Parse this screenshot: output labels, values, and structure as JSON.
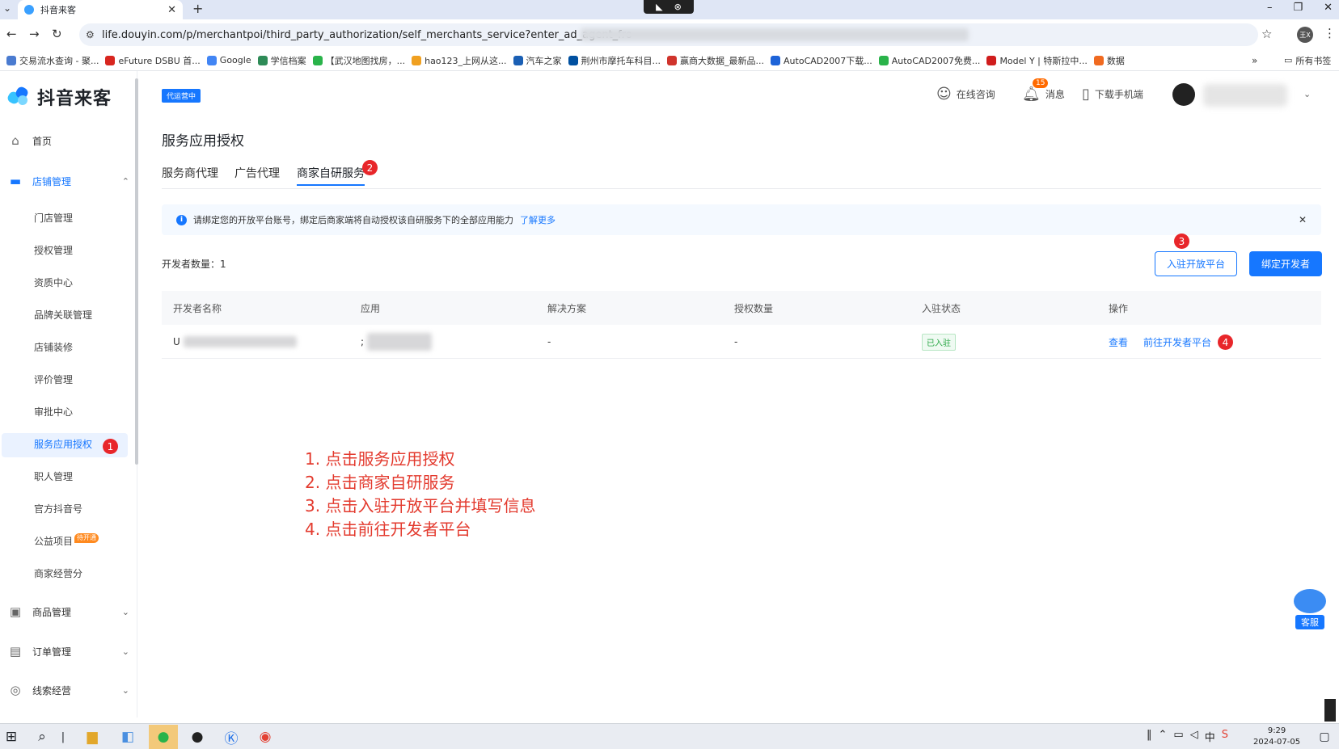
{
  "browser": {
    "tab_title": "抖音来客",
    "url": "life.douyin.com/p/merchantpoi/third_party_authorization/self_merchants_service?enter_ad_agent_fro",
    "bookmarks": [
      "交易流水查询 - 聚...",
      "eFuture DSBU 首...",
      "Google",
      "学信档案",
      "【武汉地图找房，...",
      "hao123_上网从这...",
      "汽车之家",
      "荆州市摩托车科目...",
      "赢商大数据_最新品...",
      "AutoCAD2007下载...",
      "AutoCAD2007免费...",
      "Model Y | 特斯拉中...",
      "数据"
    ],
    "bookmarks_folder": "所有书签",
    "avatar_text": "王X"
  },
  "app": {
    "logo_text": "抖音来客",
    "status_tag": "代运营中",
    "topbar": {
      "consult": "在线咨询",
      "messages": "消息",
      "messages_count": "15",
      "download": "下载手机端"
    },
    "sidebar": {
      "home": "首页",
      "store_mgmt": "店铺管理",
      "sub_items": [
        "门店管理",
        "授权管理",
        "资质中心",
        "品牌关联管理",
        "店铺装修",
        "评价管理",
        "审批中心",
        "服务应用授权",
        "职人管理",
        "官方抖音号",
        "公益项目",
        "商家经营分"
      ],
      "public_badge": "待开通",
      "goods_mgmt": "商品管理",
      "order_mgmt": "订单管理",
      "leads_mgmt": "线索经营"
    },
    "page_title": "服务应用授权",
    "tabs": [
      "服务商代理",
      "广告代理",
      "商家自研服务"
    ],
    "notice": {
      "text": "请绑定您的开放平台账号，绑定后商家端将自动授权该自研服务下的全部应用能力",
      "link": "了解更多"
    },
    "dev_count": "开发者数量：1",
    "buttons": {
      "join_platform": "入驻开放平台",
      "bind_dev": "绑定开发者"
    },
    "table": {
      "headers": [
        "开发者名称",
        "应用",
        "解决方案",
        "授权数量",
        "入驻状态",
        "操作"
      ],
      "rows": [
        {
          "dev_name": "U",
          "app": ";",
          "solution": "-",
          "auth_count": "-",
          "status": "已入驻",
          "action_view": "查看",
          "action_go": "前往开发者平台"
        }
      ]
    },
    "markers": [
      "1",
      "2",
      "3",
      "4"
    ],
    "instructions": [
      "1. 点击服务应用授权",
      "2. 点击商家自研服务",
      "3. 点击入驻开放平台并填写信息",
      "4. 点击前往开发者平台"
    ],
    "customer_service": "客服"
  },
  "taskbar": {
    "time": "9:29",
    "date": "2024-07-05"
  },
  "colors": {
    "primary": "#1677ff",
    "annotation_red": "#e33a2e",
    "success": "#29a745"
  }
}
